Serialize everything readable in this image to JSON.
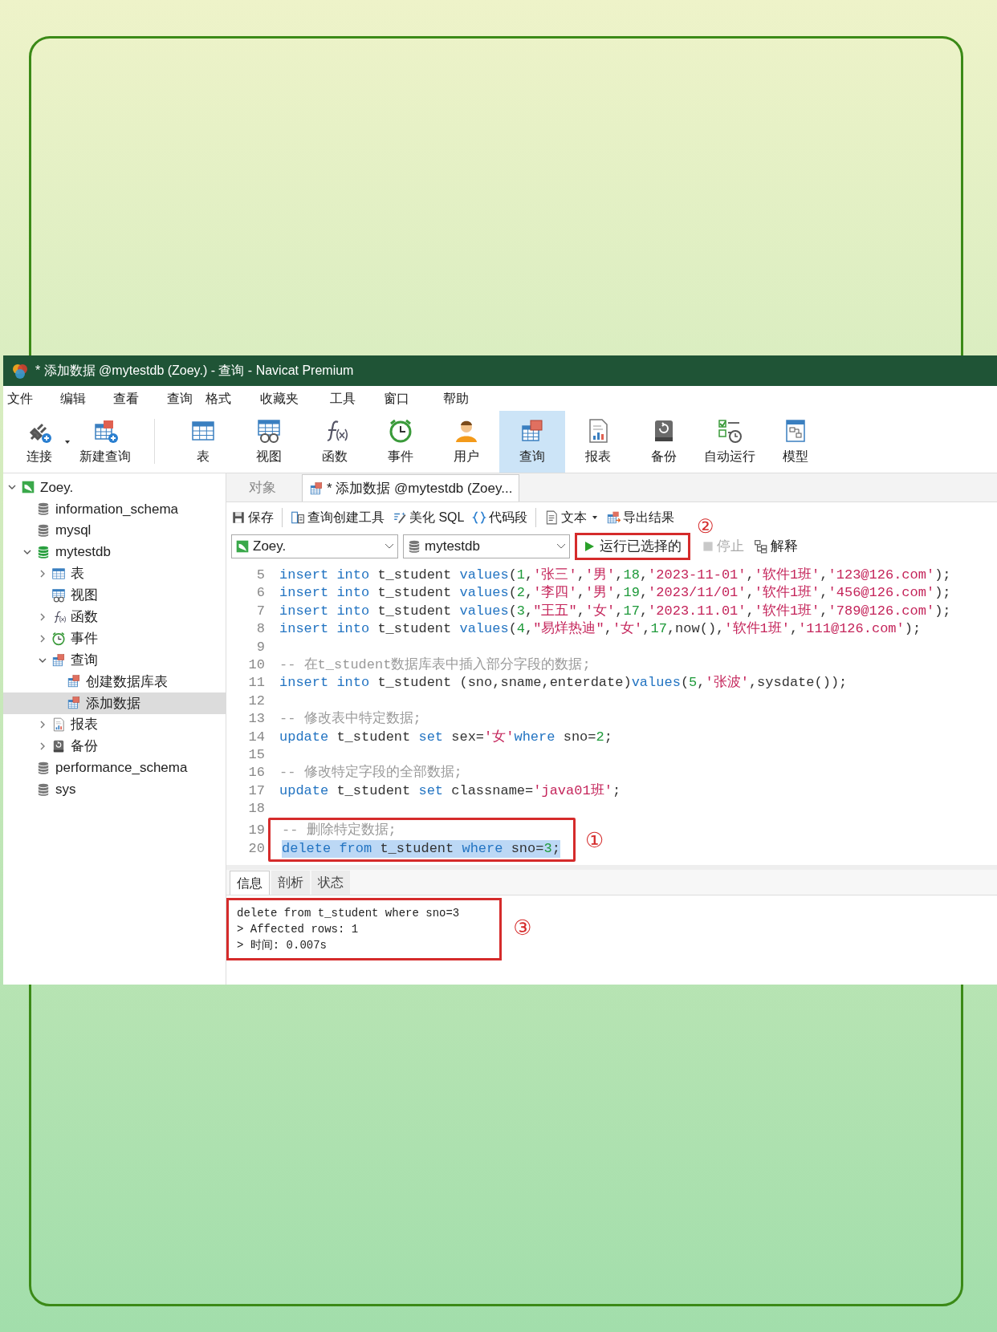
{
  "window": {
    "title": "* 添加数据 @mytestdb (Zoey.) - 查询 - Navicat Premium"
  },
  "menu": [
    "文件",
    "编辑",
    "查看",
    "查询",
    "格式",
    "收藏夹",
    "工具",
    "窗口",
    "帮助"
  ],
  "toolbar": [
    {
      "kind": "connect",
      "label": "连接",
      "selected": false,
      "dropdown": true
    },
    {
      "kind": "new_query",
      "label": "新建查询",
      "selected": false,
      "dropdown": false
    },
    {
      "kind": "table",
      "label": "表",
      "selected": false,
      "dropdown": false
    },
    {
      "kind": "view",
      "label": "视图",
      "selected": false,
      "dropdown": false
    },
    {
      "kind": "function",
      "label": "函数",
      "selected": false,
      "dropdown": false
    },
    {
      "kind": "event",
      "label": "事件",
      "selected": false,
      "dropdown": false
    },
    {
      "kind": "user",
      "label": "用户",
      "selected": false,
      "dropdown": false
    },
    {
      "kind": "query",
      "label": "查询",
      "selected": true,
      "dropdown": false
    },
    {
      "kind": "report",
      "label": "报表",
      "selected": false,
      "dropdown": false
    },
    {
      "kind": "backup",
      "label": "备份",
      "selected": false,
      "dropdown": false
    },
    {
      "kind": "schedule",
      "label": "自动运行",
      "selected": false,
      "dropdown": false
    },
    {
      "kind": "model",
      "label": "模型",
      "selected": false,
      "dropdown": false
    }
  ],
  "sidebar": {
    "items": [
      {
        "kind": "connection",
        "label": "Zoey.",
        "expandable": true,
        "expanded": true,
        "selected": false,
        "children": [
          {
            "kind": "database",
            "label": "information_schema",
            "expandable": false,
            "selected": false
          },
          {
            "kind": "database",
            "label": "mysql",
            "expandable": false,
            "selected": false
          },
          {
            "kind": "database_open",
            "label": "mytestdb",
            "expandable": true,
            "expanded": true,
            "selected": false,
            "children": [
              {
                "kind": "table",
                "label": "表",
                "expandable": true,
                "expanded": false,
                "selected": false
              },
              {
                "kind": "view",
                "label": "视图",
                "expandable": false,
                "selected": false
              },
              {
                "kind": "function",
                "label": "函数",
                "expandable": true,
                "expanded": false,
                "selected": false
              },
              {
                "kind": "event",
                "label": "事件",
                "expandable": true,
                "expanded": false,
                "selected": false
              },
              {
                "kind": "query",
                "label": "查询",
                "expandable": true,
                "expanded": true,
                "selected": false,
                "children": [
                  {
                    "kind": "query",
                    "label": "创建数据库表",
                    "expandable": false,
                    "selected": false
                  },
                  {
                    "kind": "query",
                    "label": "添加数据",
                    "expandable": false,
                    "selected": true
                  }
                ]
              },
              {
                "kind": "report",
                "label": "报表",
                "expandable": true,
                "expanded": false,
                "selected": false
              },
              {
                "kind": "backup",
                "label": "备份",
                "expandable": true,
                "expanded": false,
                "selected": false
              }
            ]
          },
          {
            "kind": "database",
            "label": "performance_schema",
            "expandable": false,
            "selected": false
          },
          {
            "kind": "database",
            "label": "sys",
            "expandable": false,
            "selected": false
          }
        ]
      }
    ]
  },
  "tabs": [
    {
      "label": "对象",
      "selected": false,
      "kind": "objects"
    },
    {
      "label": "* 添加数据 @mytestdb (Zoey...",
      "selected": true,
      "kind": "query"
    }
  ],
  "query_toolbar": [
    {
      "kind": "save",
      "label": "保存",
      "dropdown": false,
      "separator_after": true
    },
    {
      "kind": "builder",
      "label": "查询创建工具",
      "dropdown": false,
      "separator_after": false
    },
    {
      "kind": "beautify",
      "label": "美化 SQL",
      "dropdown": false,
      "separator_after": false
    },
    {
      "kind": "snippet",
      "label": "代码段",
      "dropdown": false,
      "separator_after": true
    },
    {
      "kind": "text",
      "label": "文本",
      "dropdown": true,
      "separator_after": false
    },
    {
      "kind": "export",
      "label": "导出结果",
      "dropdown": false,
      "separator_after": false
    }
  ],
  "selectors": [
    {
      "kind": "connection",
      "value": "Zoey."
    },
    {
      "kind": "database",
      "value": "mytestdb"
    }
  ],
  "run_button": {
    "label": "运行已选择的",
    "boxed": true,
    "marker": "②"
  },
  "stop_button": {
    "label": "停止",
    "disabled": true
  },
  "explain_button": {
    "label": "解释",
    "disabled": false
  },
  "editor": {
    "blocks": [
      {
        "boxed": false,
        "lines": [
          {
            "number": "5",
            "selected": false,
            "tokens": [
              {
                "kind": "keyword",
                "text": "insert into"
              },
              {
                "kind": "plain",
                "text": " t_student "
              },
              {
                "kind": "keyword",
                "text": "values"
              },
              {
                "kind": "plain",
                "text": "("
              },
              {
                "kind": "number",
                "text": "1"
              },
              {
                "kind": "plain",
                "text": ","
              },
              {
                "kind": "string",
                "text": "'张三'"
              },
              {
                "kind": "plain",
                "text": ","
              },
              {
                "kind": "string",
                "text": "'男'"
              },
              {
                "kind": "plain",
                "text": ","
              },
              {
                "kind": "number",
                "text": "18"
              },
              {
                "kind": "plain",
                "text": ","
              },
              {
                "kind": "string",
                "text": "'2023-11-01'"
              },
              {
                "kind": "plain",
                "text": ","
              },
              {
                "kind": "string",
                "text": "'软件1班'"
              },
              {
                "kind": "plain",
                "text": ","
              },
              {
                "kind": "string",
                "text": "'123@126.com'"
              },
              {
                "kind": "plain",
                "text": ");"
              }
            ]
          },
          {
            "number": "6",
            "selected": false,
            "tokens": [
              {
                "kind": "keyword",
                "text": "insert into"
              },
              {
                "kind": "plain",
                "text": " t_student "
              },
              {
                "kind": "keyword",
                "text": "values"
              },
              {
                "kind": "plain",
                "text": "("
              },
              {
                "kind": "number",
                "text": "2"
              },
              {
                "kind": "plain",
                "text": ","
              },
              {
                "kind": "string",
                "text": "'李四'"
              },
              {
                "kind": "plain",
                "text": ","
              },
              {
                "kind": "string",
                "text": "'男'"
              },
              {
                "kind": "plain",
                "text": ","
              },
              {
                "kind": "number",
                "text": "19"
              },
              {
                "kind": "plain",
                "text": ","
              },
              {
                "kind": "string",
                "text": "'2023/11/01'"
              },
              {
                "kind": "plain",
                "text": ","
              },
              {
                "kind": "string",
                "text": "'软件1班'"
              },
              {
                "kind": "plain",
                "text": ","
              },
              {
                "kind": "string",
                "text": "'456@126.com'"
              },
              {
                "kind": "plain",
                "text": ");"
              }
            ]
          },
          {
            "number": "7",
            "selected": false,
            "tokens": [
              {
                "kind": "keyword",
                "text": "insert into"
              },
              {
                "kind": "plain",
                "text": " t_student "
              },
              {
                "kind": "keyword",
                "text": "values"
              },
              {
                "kind": "plain",
                "text": "("
              },
              {
                "kind": "number",
                "text": "3"
              },
              {
                "kind": "plain",
                "text": ","
              },
              {
                "kind": "string",
                "text": "\"王五\""
              },
              {
                "kind": "plain",
                "text": ","
              },
              {
                "kind": "string",
                "text": "'女'"
              },
              {
                "kind": "plain",
                "text": ","
              },
              {
                "kind": "number",
                "text": "17"
              },
              {
                "kind": "plain",
                "text": ","
              },
              {
                "kind": "string",
                "text": "'2023.11.01'"
              },
              {
                "kind": "plain",
                "text": ","
              },
              {
                "kind": "string",
                "text": "'软件1班'"
              },
              {
                "kind": "plain",
                "text": ","
              },
              {
                "kind": "string",
                "text": "'789@126.com'"
              },
              {
                "kind": "plain",
                "text": ");"
              }
            ]
          },
          {
            "number": "8",
            "selected": false,
            "tokens": [
              {
                "kind": "keyword",
                "text": "insert into"
              },
              {
                "kind": "plain",
                "text": " t_student "
              },
              {
                "kind": "keyword",
                "text": "values"
              },
              {
                "kind": "plain",
                "text": "("
              },
              {
                "kind": "number",
                "text": "4"
              },
              {
                "kind": "plain",
                "text": ","
              },
              {
                "kind": "string",
                "text": "\"易烊热迪\""
              },
              {
                "kind": "plain",
                "text": ","
              },
              {
                "kind": "string",
                "text": "'女'"
              },
              {
                "kind": "plain",
                "text": ","
              },
              {
                "kind": "number",
                "text": "17"
              },
              {
                "kind": "plain",
                "text": ",now(),"
              },
              {
                "kind": "string",
                "text": "'软件1班'"
              },
              {
                "kind": "plain",
                "text": ","
              },
              {
                "kind": "string",
                "text": "'111@126.com'"
              },
              {
                "kind": "plain",
                "text": ");"
              }
            ]
          },
          {
            "number": "9",
            "selected": false
          },
          {
            "number": "10",
            "selected": false,
            "tokens": [
              {
                "kind": "comment",
                "text": "-- 在t_student数据库表中插入部分字段的数据;"
              }
            ]
          },
          {
            "number": "11",
            "selected": false,
            "tokens": [
              {
                "kind": "keyword",
                "text": "insert into"
              },
              {
                "kind": "plain",
                "text": " t_student (sno,sname,enterdate)"
              },
              {
                "kind": "keyword",
                "text": "values"
              },
              {
                "kind": "plain",
                "text": "("
              },
              {
                "kind": "number",
                "text": "5"
              },
              {
                "kind": "plain",
                "text": ","
              },
              {
                "kind": "string",
                "text": "'张波'"
              },
              {
                "kind": "plain",
                "text": ",sysdate());"
              }
            ]
          },
          {
            "number": "12",
            "selected": false
          },
          {
            "number": "13",
            "selected": false,
            "tokens": [
              {
                "kind": "comment",
                "text": "-- 修改表中特定数据;"
              }
            ]
          },
          {
            "number": "14",
            "selected": false,
            "tokens": [
              {
                "kind": "keyword",
                "text": "update"
              },
              {
                "kind": "plain",
                "text": " t_student "
              },
              {
                "kind": "keyword",
                "text": "set"
              },
              {
                "kind": "plain",
                "text": " sex="
              },
              {
                "kind": "string",
                "text": "'女'"
              },
              {
                "kind": "keyword",
                "text": "where"
              },
              {
                "kind": "plain",
                "text": " sno="
              },
              {
                "kind": "number",
                "text": "2"
              },
              {
                "kind": "plain",
                "text": ";"
              }
            ]
          },
          {
            "number": "15",
            "selected": false
          },
          {
            "number": "16",
            "selected": false,
            "tokens": [
              {
                "kind": "comment",
                "text": "-- 修改特定字段的全部数据;"
              }
            ]
          },
          {
            "number": "17",
            "selected": false,
            "tokens": [
              {
                "kind": "keyword",
                "text": "update"
              },
              {
                "kind": "plain",
                "text": " t_student "
              },
              {
                "kind": "keyword",
                "text": "set"
              },
              {
                "kind": "plain",
                "text": " classname="
              },
              {
                "kind": "string",
                "text": "'java01班'"
              },
              {
                "kind": "plain",
                "text": ";"
              }
            ]
          },
          {
            "number": "18",
            "selected": false
          }
        ]
      },
      {
        "boxed": true,
        "marker": "①",
        "lines": [
          {
            "number": "19",
            "selected": false,
            "tokens": [
              {
                "kind": "comment",
                "text": "-- 删除特定数据;"
              }
            ]
          },
          {
            "number": "20",
            "selected": true,
            "tokens": [
              {
                "kind": "keyword",
                "text": "delete from"
              },
              {
                "kind": "plain",
                "text": " t_student "
              },
              {
                "kind": "keyword",
                "text": "where"
              },
              {
                "kind": "plain",
                "text": " sno="
              },
              {
                "kind": "number",
                "text": "3"
              },
              {
                "kind": "plain",
                "text": ";"
              }
            ]
          }
        ]
      }
    ]
  },
  "result_tabs": [
    {
      "label": "信息",
      "selected": true
    },
    {
      "label": "剖析",
      "selected": false
    },
    {
      "label": "状态",
      "selected": false
    }
  ],
  "result": {
    "boxed": true,
    "marker": "③",
    "lines": [
      "delete from t_student where sno=3",
      "> Affected rows: 1",
      "> 时间: 0.007s"
    ]
  }
}
